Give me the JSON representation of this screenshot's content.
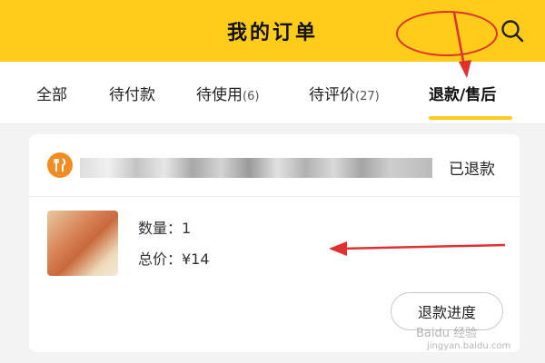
{
  "header": {
    "title": "我的订单",
    "search_icon": "search-icon",
    "background_color": "#ffcc1a"
  },
  "tabs": [
    {
      "label": "全部",
      "count": ""
    },
    {
      "label": "待付款",
      "count": ""
    },
    {
      "label": "待使用",
      "count": "(6)"
    },
    {
      "label": "待评价",
      "count": "(27)"
    },
    {
      "label": "退款/售后",
      "count": "",
      "active": true
    }
  ],
  "order": {
    "store_icon": "fork-knife-icon",
    "status": "已退款",
    "quantity": "数量：1",
    "total": "总价：¥14",
    "refund_progress_button": "退款进度"
  },
  "annotations": {
    "color": "#e03030"
  },
  "watermark": {
    "text": "Baidu 经验",
    "sub": "jingyan.baidu.com"
  }
}
